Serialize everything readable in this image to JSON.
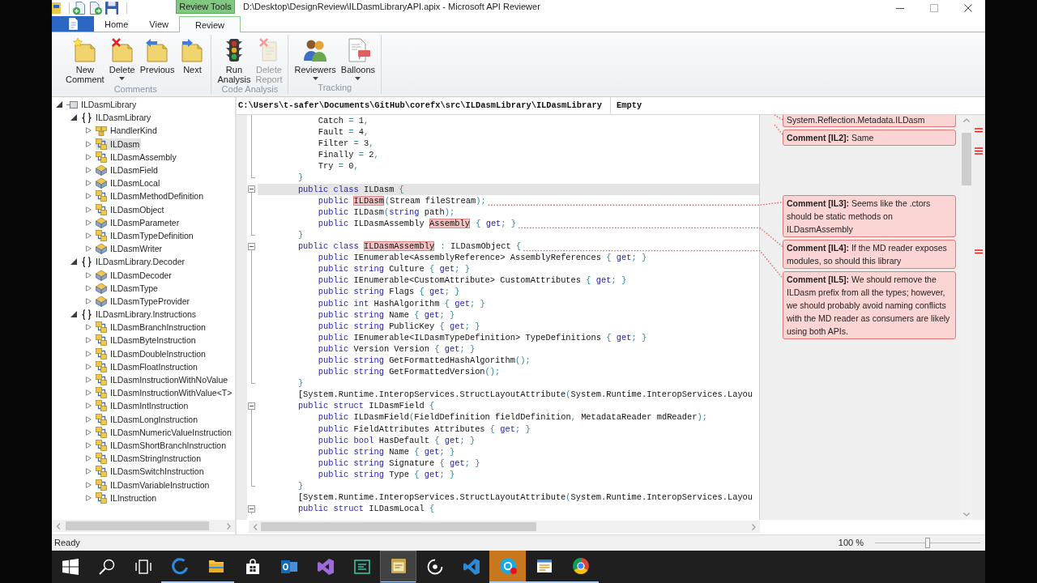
{
  "window": {
    "title": "D:\\Desktop\\DesignReview\\ILDasmLibraryAPI.apix - Microsoft API Reviewer",
    "context_tab": "Review Tools"
  },
  "ribbon": {
    "tabs": [
      {
        "label": "Home",
        "selected": false
      },
      {
        "label": "View",
        "selected": false
      },
      {
        "label": "Review",
        "selected": true
      }
    ],
    "groups": [
      {
        "label": "Comments",
        "buttons": [
          {
            "label": "New Comment",
            "kind": "new-note",
            "disabled": false,
            "dropdown": false
          },
          {
            "label": "Delete",
            "kind": "delete-note",
            "disabled": false,
            "dropdown": true
          },
          {
            "label": "Previous",
            "kind": "previous-note",
            "disabled": false,
            "dropdown": false
          },
          {
            "label": "Next",
            "kind": "next-note",
            "disabled": false,
            "dropdown": false
          }
        ]
      },
      {
        "label": "Code Analysis",
        "buttons": [
          {
            "label": "Run Analysis",
            "kind": "run-analysis",
            "disabled": false,
            "dropdown": false
          },
          {
            "label": "Delete Report",
            "kind": "delete-report",
            "disabled": true,
            "dropdown": false
          }
        ]
      },
      {
        "label": "Tracking",
        "buttons": [
          {
            "label": "Reviewers",
            "kind": "reviewers",
            "disabled": false,
            "dropdown": true
          },
          {
            "label": "Balloons",
            "kind": "balloons",
            "disabled": false,
            "dropdown": true
          }
        ]
      }
    ]
  },
  "tree": [
    {
      "label": "ILDasmLibrary",
      "kind": "assembly",
      "expanded": true,
      "selected": false,
      "children": [
        {
          "label": "ILDasmLibrary",
          "kind": "namespace",
          "expanded": true,
          "selected": false,
          "children": [
            {
              "label": "HandlerKind",
              "kind": "enum",
              "expanded": false,
              "selected": false
            },
            {
              "label": "ILDasm",
              "kind": "class",
              "expanded": false,
              "selected": true
            },
            {
              "label": "ILDasmAssembly",
              "kind": "class",
              "expanded": false,
              "selected": false
            },
            {
              "label": "ILDasmField",
              "kind": "struct",
              "expanded": false,
              "selected": false
            },
            {
              "label": "ILDasmLocal",
              "kind": "struct",
              "expanded": false,
              "selected": false
            },
            {
              "label": "ILDasmMethodDefinition",
              "kind": "class",
              "expanded": false,
              "selected": false
            },
            {
              "label": "ILDasmObject",
              "kind": "class",
              "expanded": false,
              "selected": false
            },
            {
              "label": "ILDasmParameter",
              "kind": "struct",
              "expanded": false,
              "selected": false
            },
            {
              "label": "ILDasmTypeDefinition",
              "kind": "class",
              "expanded": false,
              "selected": false
            },
            {
              "label": "ILDasmWriter",
              "kind": "struct",
              "expanded": false,
              "selected": false
            }
          ]
        },
        {
          "label": "ILDasmLibrary.Decoder",
          "kind": "namespace",
          "expanded": true,
          "selected": false,
          "children": [
            {
              "label": "ILDasmDecoder",
              "kind": "struct",
              "expanded": false,
              "selected": false
            },
            {
              "label": "ILDasmType",
              "kind": "struct",
              "expanded": false,
              "selected": false
            },
            {
              "label": "ILDasmTypeProvider",
              "kind": "struct",
              "expanded": false,
              "selected": false
            }
          ]
        },
        {
          "label": "ILDasmLibrary.Instructions",
          "kind": "namespace",
          "expanded": true,
          "selected": false,
          "children": [
            {
              "label": "ILDasmBranchInstruction",
              "kind": "class",
              "expanded": false,
              "selected": false
            },
            {
              "label": "ILDasmByteInstruction",
              "kind": "class",
              "expanded": false,
              "selected": false
            },
            {
              "label": "ILDasmDoubleInstruction",
              "kind": "class",
              "expanded": false,
              "selected": false
            },
            {
              "label": "ILDasmFloatInstruction",
              "kind": "class",
              "expanded": false,
              "selected": false
            },
            {
              "label": "ILDasmInstructionWithNoValue",
              "kind": "class",
              "expanded": false,
              "selected": false
            },
            {
              "label": "ILDasmInstructionWithValue<T>",
              "kind": "class",
              "expanded": false,
              "selected": false
            },
            {
              "label": "ILDasmIntInstruction",
              "kind": "class",
              "expanded": false,
              "selected": false
            },
            {
              "label": "ILDasmLongInstruction",
              "kind": "class",
              "expanded": false,
              "selected": false
            },
            {
              "label": "ILDasmNumericValueInstruction",
              "kind": "class",
              "expanded": false,
              "selected": false
            },
            {
              "label": "ILDasmShortBranchInstruction",
              "kind": "class",
              "expanded": false,
              "selected": false
            },
            {
              "label": "ILDasmStringInstruction",
              "kind": "class",
              "expanded": false,
              "selected": false
            },
            {
              "label": "ILDasmSwitchInstruction",
              "kind": "class",
              "expanded": false,
              "selected": false
            },
            {
              "label": "ILDasmVariableInstruction",
              "kind": "class",
              "expanded": false,
              "selected": false
            },
            {
              "label": "ILInstruction",
              "kind": "class",
              "expanded": false,
              "selected": false
            }
          ]
        }
      ]
    }
  ],
  "editor": {
    "path": "C:\\Users\\t-safer\\Documents\\GitHub\\corefx\\src\\ILDasmLibrary\\ILDasmLibrary",
    "member": "Empty",
    "lines": [
      {
        "kind": "code",
        "selected": false,
        "spans": [
          {
            "kind": "text",
            "text": "            Catch "
          },
          {
            "kind": "punct",
            "text": "="
          },
          {
            "kind": "text",
            "text": " 1"
          },
          {
            "kind": "punct",
            "text": ","
          }
        ]
      },
      {
        "kind": "code",
        "selected": false,
        "spans": [
          {
            "kind": "text",
            "text": "            Fault "
          },
          {
            "kind": "punct",
            "text": "="
          },
          {
            "kind": "text",
            "text": " 4"
          },
          {
            "kind": "punct",
            "text": ","
          }
        ]
      },
      {
        "kind": "code",
        "selected": false,
        "spans": [
          {
            "kind": "text",
            "text": "            Filter "
          },
          {
            "kind": "punct",
            "text": "="
          },
          {
            "kind": "text",
            "text": " 3"
          },
          {
            "kind": "punct",
            "text": ","
          }
        ]
      },
      {
        "kind": "code",
        "selected": false,
        "spans": [
          {
            "kind": "text",
            "text": "            Finally "
          },
          {
            "kind": "punct",
            "text": "="
          },
          {
            "kind": "text",
            "text": " 2"
          },
          {
            "kind": "punct",
            "text": ","
          }
        ]
      },
      {
        "kind": "code",
        "selected": false,
        "spans": [
          {
            "kind": "text",
            "text": "            Try "
          },
          {
            "kind": "punct",
            "text": "="
          },
          {
            "kind": "text",
            "text": " 0"
          },
          {
            "kind": "punct",
            "text": ","
          }
        ]
      },
      {
        "kind": "block-end",
        "selected": false,
        "spans": [
          {
            "kind": "punct",
            "text": "        }"
          }
        ]
      },
      {
        "kind": "block-start",
        "selected": true,
        "spans": [
          {
            "kind": "keyword",
            "text": "        public class"
          },
          {
            "kind": "text",
            "text": " ILDasm "
          },
          {
            "kind": "punct",
            "text": "{"
          }
        ]
      },
      {
        "kind": "code",
        "selected": false,
        "spans": [
          {
            "kind": "keyword",
            "text": "            public "
          },
          {
            "kind": "flagged",
            "text": "ILDasm"
          },
          {
            "kind": "punct",
            "text": "("
          },
          {
            "kind": "text",
            "text": "Stream fileStream"
          },
          {
            "kind": "punct",
            "text": ");"
          }
        ]
      },
      {
        "kind": "code",
        "selected": false,
        "spans": [
          {
            "kind": "keyword",
            "text": "            public"
          },
          {
            "kind": "text",
            "text": " ILDasm"
          },
          {
            "kind": "punct",
            "text": "("
          },
          {
            "kind": "keyword",
            "text": "string"
          },
          {
            "kind": "text",
            "text": " path"
          },
          {
            "kind": "punct",
            "text": ");"
          }
        ]
      },
      {
        "kind": "code",
        "selected": false,
        "spans": [
          {
            "kind": "keyword",
            "text": "            public"
          },
          {
            "kind": "text",
            "text": " ILDasmAssembly "
          },
          {
            "kind": "flagged",
            "text": "Assembly"
          },
          {
            "kind": "punct",
            "text": " { "
          },
          {
            "kind": "keyword",
            "text": "get"
          },
          {
            "kind": "punct",
            "text": "; }"
          }
        ]
      },
      {
        "kind": "block-end",
        "selected": false,
        "spans": [
          {
            "kind": "punct",
            "text": "        }"
          }
        ]
      },
      {
        "kind": "block-start",
        "selected": false,
        "spans": [
          {
            "kind": "keyword",
            "text": "        public class "
          },
          {
            "kind": "flagged",
            "text": "ILDasmAssembly"
          },
          {
            "kind": "punct",
            "text": " :"
          },
          {
            "kind": "text",
            "text": " ILDasmObject "
          },
          {
            "kind": "punct",
            "text": "{"
          }
        ]
      },
      {
        "kind": "code",
        "selected": false,
        "spans": [
          {
            "kind": "keyword",
            "text": "            public"
          },
          {
            "kind": "text",
            "text": " IEnumerable<AssemblyReference> AssemblyReferences "
          },
          {
            "kind": "punct",
            "text": "{ "
          },
          {
            "kind": "keyword",
            "text": "get"
          },
          {
            "kind": "punct",
            "text": "; }"
          }
        ]
      },
      {
        "kind": "code",
        "selected": false,
        "spans": [
          {
            "kind": "keyword",
            "text": "            public string"
          },
          {
            "kind": "text",
            "text": " Culture "
          },
          {
            "kind": "punct",
            "text": "{ "
          },
          {
            "kind": "keyword",
            "text": "get"
          },
          {
            "kind": "punct",
            "text": "; }"
          }
        ]
      },
      {
        "kind": "code",
        "selected": false,
        "spans": [
          {
            "kind": "keyword",
            "text": "            public"
          },
          {
            "kind": "text",
            "text": " IEnumerable<CustomAttribute> CustomAttributes "
          },
          {
            "kind": "punct",
            "text": "{ "
          },
          {
            "kind": "keyword",
            "text": "get"
          },
          {
            "kind": "punct",
            "text": "; }"
          }
        ]
      },
      {
        "kind": "code",
        "selected": false,
        "spans": [
          {
            "kind": "keyword",
            "text": "            public string"
          },
          {
            "kind": "text",
            "text": " Flags "
          },
          {
            "kind": "punct",
            "text": "{ "
          },
          {
            "kind": "keyword",
            "text": "get"
          },
          {
            "kind": "punct",
            "text": "; }"
          }
        ]
      },
      {
        "kind": "code",
        "selected": false,
        "spans": [
          {
            "kind": "keyword",
            "text": "            public int"
          },
          {
            "kind": "text",
            "text": " HashAlgorithm "
          },
          {
            "kind": "punct",
            "text": "{ "
          },
          {
            "kind": "keyword",
            "text": "get"
          },
          {
            "kind": "punct",
            "text": "; }"
          }
        ]
      },
      {
        "kind": "code",
        "selected": false,
        "spans": [
          {
            "kind": "keyword",
            "text": "            public string"
          },
          {
            "kind": "text",
            "text": " Name "
          },
          {
            "kind": "punct",
            "text": "{ "
          },
          {
            "kind": "keyword",
            "text": "get"
          },
          {
            "kind": "punct",
            "text": "; }"
          }
        ]
      },
      {
        "kind": "code",
        "selected": false,
        "spans": [
          {
            "kind": "keyword",
            "text": "            public string"
          },
          {
            "kind": "text",
            "text": " PublicKey "
          },
          {
            "kind": "punct",
            "text": "{ "
          },
          {
            "kind": "keyword",
            "text": "get"
          },
          {
            "kind": "punct",
            "text": "; }"
          }
        ]
      },
      {
        "kind": "code",
        "selected": false,
        "spans": [
          {
            "kind": "keyword",
            "text": "            public"
          },
          {
            "kind": "text",
            "text": " IEnumerable<ILDasmTypeDefinition> TypeDefinitions "
          },
          {
            "kind": "punct",
            "text": "{ "
          },
          {
            "kind": "keyword",
            "text": "get"
          },
          {
            "kind": "punct",
            "text": "; }"
          }
        ]
      },
      {
        "kind": "code",
        "selected": false,
        "spans": [
          {
            "kind": "keyword",
            "text": "            public"
          },
          {
            "kind": "text",
            "text": " Version Version "
          },
          {
            "kind": "punct",
            "text": "{ "
          },
          {
            "kind": "keyword",
            "text": "get"
          },
          {
            "kind": "punct",
            "text": "; }"
          }
        ]
      },
      {
        "kind": "code",
        "selected": false,
        "spans": [
          {
            "kind": "keyword",
            "text": "            public string"
          },
          {
            "kind": "text",
            "text": " GetFormattedHashAlgorithm"
          },
          {
            "kind": "punct",
            "text": "();"
          }
        ]
      },
      {
        "kind": "code",
        "selected": false,
        "spans": [
          {
            "kind": "keyword",
            "text": "            public string"
          },
          {
            "kind": "text",
            "text": " GetFormattedVersion"
          },
          {
            "kind": "punct",
            "text": "();"
          }
        ]
      },
      {
        "kind": "block-end",
        "selected": false,
        "spans": [
          {
            "kind": "punct",
            "text": "        }"
          }
        ]
      },
      {
        "kind": "code",
        "selected": false,
        "spans": [
          {
            "kind": "text",
            "text": "        [System.Runtime.InteropServices.StructLayoutAttribute"
          },
          {
            "kind": "punct",
            "text": "("
          },
          {
            "kind": "text",
            "text": "System.Runtime.InteropServices.Layou"
          }
        ]
      },
      {
        "kind": "block-start",
        "selected": false,
        "spans": [
          {
            "kind": "keyword",
            "text": "        public struct"
          },
          {
            "kind": "text",
            "text": " ILDasmField "
          },
          {
            "kind": "punct",
            "text": "{"
          }
        ]
      },
      {
        "kind": "code",
        "selected": false,
        "spans": [
          {
            "kind": "keyword",
            "text": "            public"
          },
          {
            "kind": "text",
            "text": " ILDasmField"
          },
          {
            "kind": "punct",
            "text": "("
          },
          {
            "kind": "text",
            "text": "FieldDefinition fieldDefinition"
          },
          {
            "kind": "punct",
            "text": ","
          },
          {
            "kind": "text",
            "text": " MetadataReader mdReader"
          },
          {
            "kind": "punct",
            "text": ");"
          }
        ]
      },
      {
        "kind": "code",
        "selected": false,
        "spans": [
          {
            "kind": "keyword",
            "text": "            public"
          },
          {
            "kind": "text",
            "text": " FieldAttributes Attributes "
          },
          {
            "kind": "punct",
            "text": "{ "
          },
          {
            "kind": "keyword",
            "text": "get"
          },
          {
            "kind": "punct",
            "text": "; }"
          }
        ]
      },
      {
        "kind": "code",
        "selected": false,
        "spans": [
          {
            "kind": "keyword",
            "text": "            public bool"
          },
          {
            "kind": "text",
            "text": " HasDefault "
          },
          {
            "kind": "punct",
            "text": "{ "
          },
          {
            "kind": "keyword",
            "text": "get"
          },
          {
            "kind": "punct",
            "text": "; }"
          }
        ]
      },
      {
        "kind": "code",
        "selected": false,
        "spans": [
          {
            "kind": "keyword",
            "text": "            public string"
          },
          {
            "kind": "text",
            "text": " Name "
          },
          {
            "kind": "punct",
            "text": "{ "
          },
          {
            "kind": "keyword",
            "text": "get"
          },
          {
            "kind": "punct",
            "text": "; }"
          }
        ]
      },
      {
        "kind": "code",
        "selected": false,
        "spans": [
          {
            "kind": "keyword",
            "text": "            public string"
          },
          {
            "kind": "text",
            "text": " Signature "
          },
          {
            "kind": "punct",
            "text": "{ "
          },
          {
            "kind": "keyword",
            "text": "get"
          },
          {
            "kind": "punct",
            "text": "; }"
          }
        ]
      },
      {
        "kind": "code",
        "selected": false,
        "spans": [
          {
            "kind": "keyword",
            "text": "            public string"
          },
          {
            "kind": "text",
            "text": " Type "
          },
          {
            "kind": "punct",
            "text": "{ "
          },
          {
            "kind": "keyword",
            "text": "get"
          },
          {
            "kind": "punct",
            "text": "; }"
          }
        ]
      },
      {
        "kind": "block-end",
        "selected": false,
        "spans": [
          {
            "kind": "punct",
            "text": "        }"
          }
        ]
      },
      {
        "kind": "code",
        "selected": false,
        "spans": [
          {
            "kind": "text",
            "text": "        [System.Runtime.InteropServices.StructLayoutAttribute"
          },
          {
            "kind": "punct",
            "text": "("
          },
          {
            "kind": "text",
            "text": "System.Runtime.InteropServices.Layou"
          }
        ]
      },
      {
        "kind": "block-start",
        "selected": false,
        "spans": [
          {
            "kind": "keyword",
            "text": "        public struct"
          },
          {
            "kind": "text",
            "text": " ILDasmLocal "
          },
          {
            "kind": "punct",
            "text": "{"
          }
        ]
      }
    ]
  },
  "comments": [
    {
      "kind": "continued",
      "text": "System.Reflection.Metadata.ILDasm"
    },
    {
      "kind": "full",
      "text": "**Comment [IL2]:** Same"
    },
    {
      "kind": "full",
      "text": "**Comment [IL3]:** Seems like the .ctors should be static methods on ILDasmAssembly"
    },
    {
      "kind": "full",
      "text": "**Comment [IL4]:** If the MD reader exposes modules, so should this library"
    },
    {
      "kind": "full",
      "text": "**Comment [IL5]:** We should remove the ILDasm prefix from all the types; however, we should probably avoid naming conflicts with the MD reader as consumers are likely using both APIs."
    }
  ],
  "status_bar": {
    "text": "Ready",
    "zoom": "100 %",
    "zoom_slider": {
      "level": 0.5
    }
  },
  "taskbar": {
    "apps": [
      {
        "kind": "start",
        "running": false,
        "selected": false,
        "flashing": false,
        "alert": false
      },
      {
        "kind": "search",
        "running": false,
        "selected": false,
        "flashing": false,
        "alert": false
      },
      {
        "kind": "task-view",
        "running": false,
        "selected": false,
        "flashing": false,
        "alert": false
      },
      {
        "kind": "edge",
        "running": true,
        "selected": false,
        "flashing": false,
        "alert": false
      },
      {
        "kind": "explorer",
        "running": true,
        "selected": false,
        "flashing": false,
        "alert": false
      },
      {
        "kind": "store",
        "running": false,
        "selected": false,
        "flashing": false,
        "alert": false
      },
      {
        "kind": "outlook",
        "running": false,
        "selected": false,
        "flashing": false,
        "alert": false
      },
      {
        "kind": "visual-studio",
        "running": false,
        "selected": false,
        "flashing": false,
        "alert": false
      },
      {
        "kind": "editor-app",
        "running": false,
        "selected": false,
        "flashing": false,
        "alert": false
      },
      {
        "kind": "reviewer",
        "running": true,
        "selected": true,
        "flashing": false,
        "alert": false
      },
      {
        "kind": "groove",
        "running": false,
        "selected": false,
        "flashing": false,
        "alert": false
      },
      {
        "kind": "vscode",
        "running": false,
        "selected": false,
        "flashing": false,
        "alert": false
      },
      {
        "kind": "skype",
        "running": true,
        "selected": false,
        "flashing": true,
        "alert": true
      },
      {
        "kind": "notes",
        "running": true,
        "selected": false,
        "flashing": false,
        "alert": false
      },
      {
        "kind": "chrome",
        "running": true,
        "selected": false,
        "flashing": false,
        "alert": false
      }
    ]
  }
}
